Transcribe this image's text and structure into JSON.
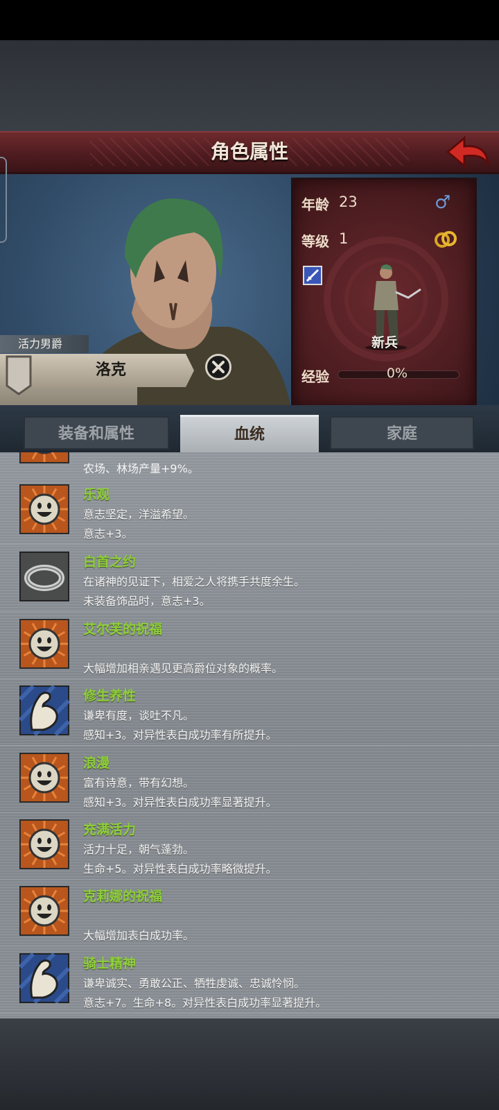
{
  "header": {
    "title": "角色属性"
  },
  "character": {
    "title": "活力男爵",
    "name": "洛克",
    "age_label": "年龄",
    "age": "23",
    "level_label": "等级",
    "level": "1",
    "class": "新兵",
    "exp_label": "经验",
    "exp_value": "0%",
    "exp_progress": 0
  },
  "tabs": [
    {
      "label": "装备和属性",
      "active": false
    },
    {
      "label": "血统",
      "active": true
    },
    {
      "label": "家庭",
      "active": false
    }
  ],
  "traits_partial": {
    "desc": "农场、林场产量+9%。",
    "icon": "smiley-icon"
  },
  "traits": [
    {
      "name": "乐观",
      "desc1": "意志坚定，洋溢希望。",
      "desc2": "意志+3。",
      "icon": "smiley-icon"
    },
    {
      "name": "白首之约",
      "desc1": "在诸神的见证下，相爱之人将携手共度余生。",
      "desc2": "未装备饰品时，意志+3。",
      "icon": "ring-icon"
    },
    {
      "name": "艾尔芙的祝福",
      "desc1": "",
      "desc2": "大幅增加相亲遇见更高爵位对象的概率。",
      "icon": "smiley-icon"
    },
    {
      "name": "修生养性",
      "desc1": "谦卑有度，谈吐不凡。",
      "desc2": "感知+3。对异性表白成功率有所提升。",
      "icon": "arm-icon"
    },
    {
      "name": "浪漫",
      "desc1": "富有诗意，带有幻想。",
      "desc2": "感知+3。对异性表白成功率显著提升。",
      "icon": "smiley-icon"
    },
    {
      "name": "充满活力",
      "desc1": "活力十足，朝气蓬勃。",
      "desc2": "生命+5。对异性表白成功率略微提升。",
      "icon": "smiley-icon"
    },
    {
      "name": "克莉娜的祝福",
      "desc1": "",
      "desc2": "大幅增加表白成功率。",
      "icon": "smiley-icon"
    },
    {
      "name": "骑士精神",
      "desc1": "谦卑诚实、勇敢公正、牺牲虔诚、忠诚怜悯。",
      "desc2": "意志+7。生命+8。对异性表白成功率显著提升。",
      "icon": "arm-icon"
    }
  ],
  "colors": {
    "trait_name": "#8fcf3c",
    "title_bar": "#5a2226",
    "gender": "#6a9ad6"
  }
}
